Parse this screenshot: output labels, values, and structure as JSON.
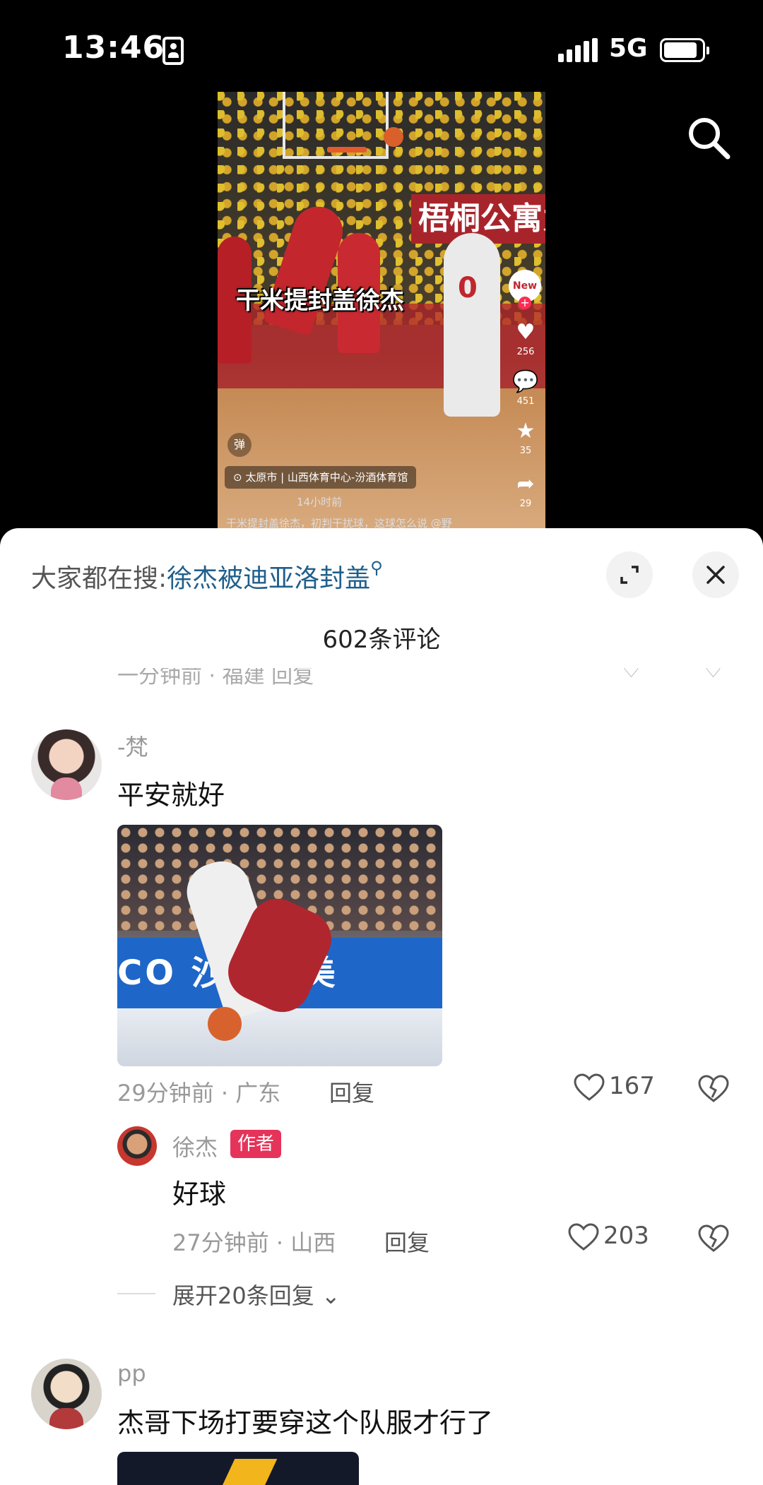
{
  "status_bar": {
    "time": "13:46",
    "network": "5G"
  },
  "video": {
    "banner_text": "梧桐公寓为",
    "jersey_number": "0",
    "caption": "干米提封盖徐杰",
    "author_badge": "New",
    "likes": "256",
    "comments": "451",
    "favorites": "35",
    "shares": "29",
    "danmu_label": "弹",
    "location": "太原市 | 山西体育中心-汾酒体育馆",
    "time_ago": "14小时前",
    "description": "干米提封盖徐杰，初判干扰球，这球怎么说 @野"
  },
  "sheet": {
    "hot_search_prefix": "大家都在搜:",
    "hot_search_term": "徐杰被迪亚洛封盖",
    "comment_count": "602条评论",
    "comments": [
      {
        "user": "-梵",
        "text": "平安就好",
        "image_text": "CO 沙特阿美",
        "meta": "29分钟前 · 广东",
        "reply_label": "回复",
        "likes": "167",
        "replies": [
          {
            "user": "徐杰",
            "badge": "作者",
            "text": "好球",
            "meta": "27分钟前 · 山西",
            "reply_label": "回复",
            "likes": "203"
          }
        ],
        "expand_label": "展开20条回复"
      },
      {
        "user": "pp",
        "text": "杰哥下场打要穿这个队服才行了"
      }
    ]
  },
  "icons": {
    "search": "search-icon",
    "expand": "expand-icon",
    "close": "close-icon",
    "like": "heart-icon",
    "dislike": "broken-heart-icon"
  },
  "colors": {
    "hot_term": "#1f5f8b",
    "author_badge": "#e6335a",
    "sheet_bg": "#ffffff",
    "background": "#000000"
  }
}
